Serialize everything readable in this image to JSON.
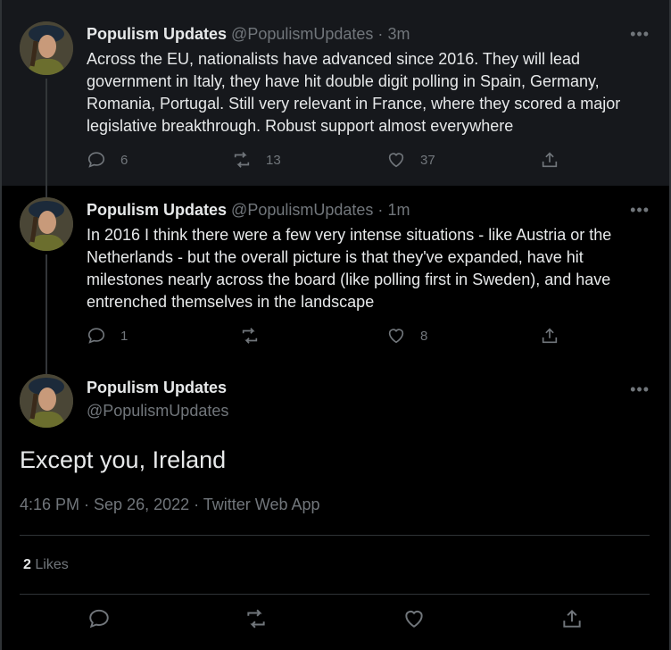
{
  "tweets": [
    {
      "name": "Populism Updates",
      "handle": "@PopulismUpdates",
      "time": "3m",
      "text": "Across the EU, nationalists have advanced since 2016. They will lead government in Italy, they have hit double digit polling in Spain, Germany, Romania, Portugal. Still very relevant in France, where they scored a major legislative breakthrough. Robust support almost everywhere",
      "replies": "6",
      "retweets": "13",
      "likes": "37"
    },
    {
      "name": "Populism Updates",
      "handle": "@PopulismUpdates",
      "time": "1m",
      "text": "In 2016 I think there were a few very intense situations - like Austria or the Netherlands - but the overall picture is that they've expanded, have hit milestones nearly across the board (like polling first in Sweden), and have entrenched themselves in the landscape",
      "replies": "1",
      "retweets": "",
      "likes": "8"
    }
  ],
  "main_tweet": {
    "name": "Populism Updates",
    "handle": "@PopulismUpdates",
    "text": "Except you, Ireland",
    "meta": "4:16 PM · Sep 26, 2022 · Twitter Web App",
    "likes_count": "2",
    "likes_label": "Likes"
  },
  "ui": {
    "dot": "·",
    "more": "•••"
  },
  "icons": [
    "reply-icon",
    "retweet-icon",
    "like-icon",
    "share-icon",
    "more-icon"
  ],
  "colors": {
    "background": "#000000",
    "highlight": "#16181c",
    "muted": "#71767b",
    "text": "#e7e9ea"
  }
}
